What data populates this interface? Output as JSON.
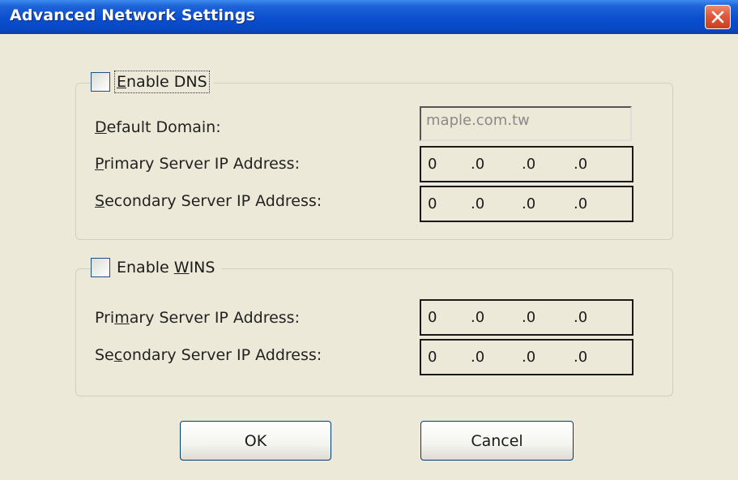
{
  "window": {
    "title": "Advanced Network Settings",
    "close_icon": "close-icon"
  },
  "dns": {
    "enable_label_prefix": "",
    "enable_label_mnemonic": "E",
    "enable_label_rest": "nable DNS",
    "checked": false,
    "default_domain_label_mnemonic": "D",
    "default_domain_label_rest": "efault Domain:",
    "default_domain_value": "maple.com.tw",
    "primary_label_mnemonic": "P",
    "primary_label_rest": "rimary Server IP Address:",
    "primary_ip": [
      "0",
      ".0",
      ".0",
      ".0"
    ],
    "secondary_label_mnemonic": "S",
    "secondary_label_rest": "econdary Server IP Address:",
    "secondary_ip": [
      "0",
      ".0",
      ".0",
      ".0"
    ]
  },
  "wins": {
    "enable_label_prefix": "Enable ",
    "enable_label_mnemonic": "W",
    "enable_label_rest": "INS",
    "checked": false,
    "primary_label_prefix": "Pri",
    "primary_label_mnemonic": "m",
    "primary_label_rest": "ary Server IP Address:",
    "primary_ip": [
      "0",
      ".0",
      ".0",
      ".0"
    ],
    "secondary_label_prefix": "Se",
    "secondary_label_mnemonic": "c",
    "secondary_label_rest": "ondary Server IP Address:",
    "secondary_ip": [
      "0",
      ".0",
      ".0",
      ".0"
    ]
  },
  "buttons": {
    "ok": "OK",
    "cancel": "Cancel"
  },
  "colors": {
    "titlebar": "#0a4ecf",
    "dialog_bg": "#ece9d8",
    "close_button": "#e0583b"
  }
}
